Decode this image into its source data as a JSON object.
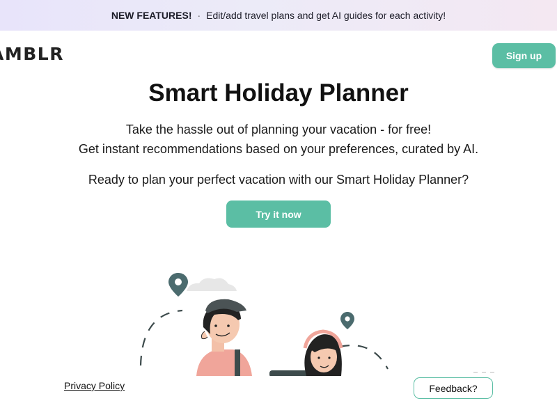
{
  "announcement": {
    "tag": "NEW FEATURES!",
    "separator": "·",
    "text": "Edit/add travel plans and get AI guides for each activity!"
  },
  "header": {
    "logo_text": "AMBLR",
    "signup_label": "Sign up"
  },
  "hero": {
    "title": "Smart Holiday Planner",
    "subtitle_line1": "Take the hassle out of planning your vacation - for free!",
    "subtitle_line2": "Get instant recommendations based on your preferences, curated by AI.",
    "cta_prompt": "Ready to plan your perfect vacation with our Smart Holiday Planner?",
    "cta_button": "Try it now"
  },
  "illustration": {
    "icons": [
      "location-pin-icon",
      "cloud-icon",
      "traveler-man",
      "traveler-woman"
    ]
  },
  "footer": {
    "privacy_label": "Privacy Policy",
    "feedback_label": "Feedback?"
  },
  "colors": {
    "accent": "#5bbea4",
    "pin": "#4b6b6e",
    "banner_start": "#e8e4fa",
    "banner_end": "#f4e8f2"
  }
}
